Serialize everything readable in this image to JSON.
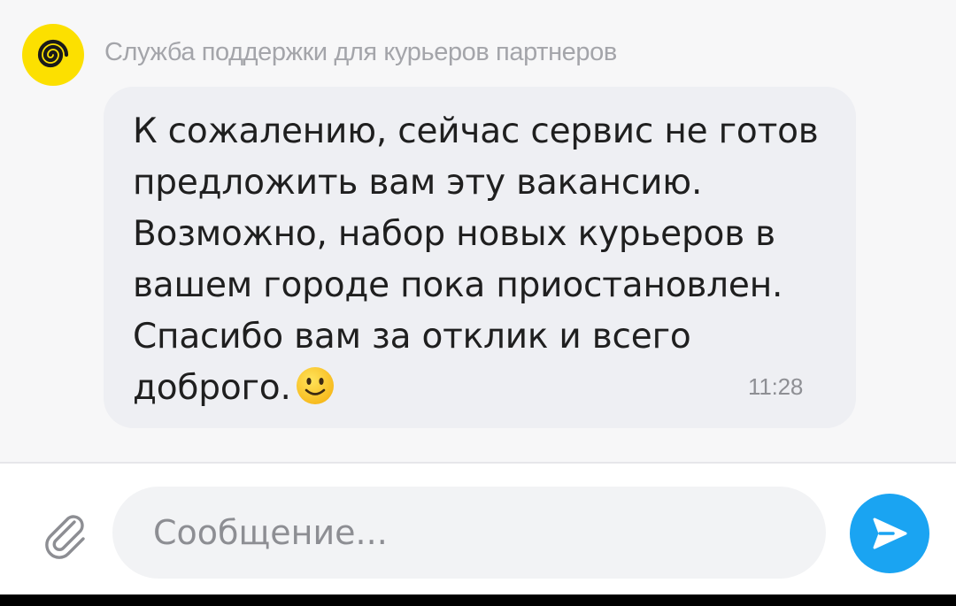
{
  "chat": {
    "sender_name": "Служба поддержки для курьеров партнеров",
    "message": {
      "text": "К сожалению, сейчас сервис не готов предложить вам эту вакансию. Возможно, набор новых курьеров в вашем городе пока приостановлен. Спасибо вам за отклик и всего доброго.",
      "emoji": "slightly-smiling-face",
      "time": "11:28"
    }
  },
  "composer": {
    "placeholder": "Сообщение...",
    "value": "",
    "attach_icon": "paperclip-icon",
    "send_icon": "send-arrow-icon"
  },
  "colors": {
    "avatar_bg": "#fce000",
    "bubble_bg": "#eeeff3",
    "send_button": "#1aa4f2",
    "sender_name": "#a4a5aa"
  }
}
